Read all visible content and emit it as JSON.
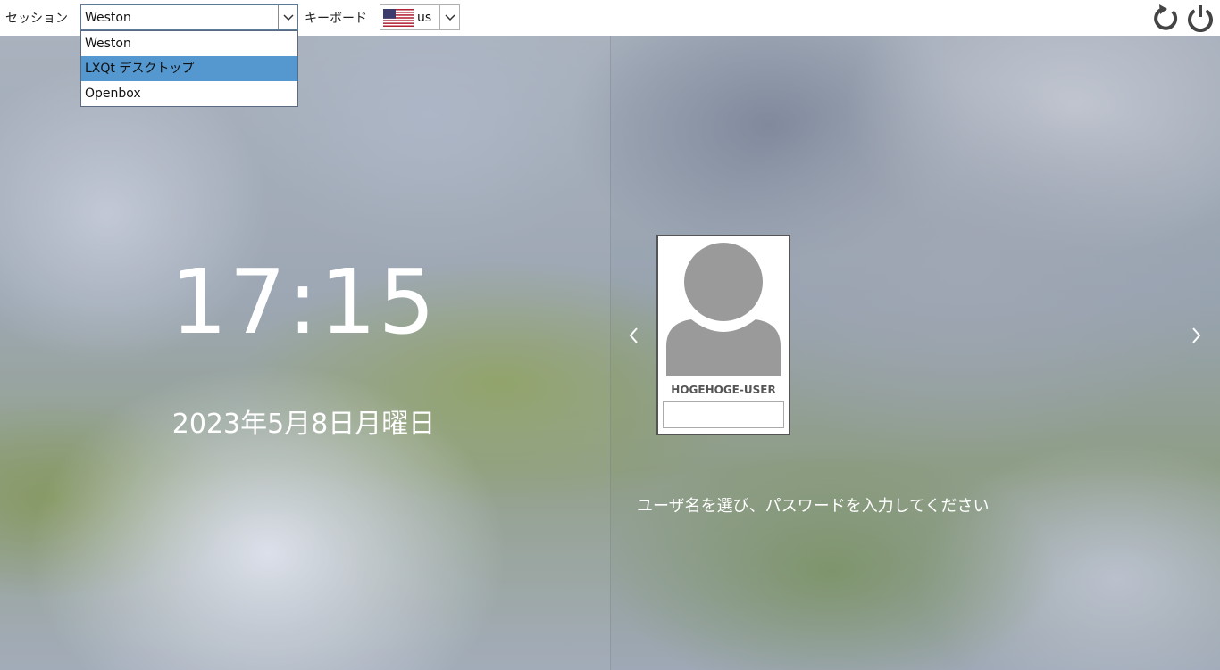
{
  "topbar": {
    "session_label": "セッション",
    "session_selected": "Weston",
    "keyboard_label": "キーボード",
    "keyboard_layout": "us",
    "restart_icon": "restart-icon",
    "power_icon": "power-icon"
  },
  "session_list": {
    "options": [
      "Weston",
      "LXQt デスクトップ",
      "Openbox"
    ],
    "highlighted": "LXQt デスクトップ"
  },
  "clock": {
    "time": "17:15",
    "date": "2023年5月8日月曜日"
  },
  "user": {
    "name": "HOGEHOGE-USER",
    "password": ""
  },
  "prompt": "ユーザ名を選び、パスワードを入力してください",
  "colors": {
    "highlight": "#5597cf",
    "icon": "#444444",
    "avatar": "#9a9a9a"
  }
}
